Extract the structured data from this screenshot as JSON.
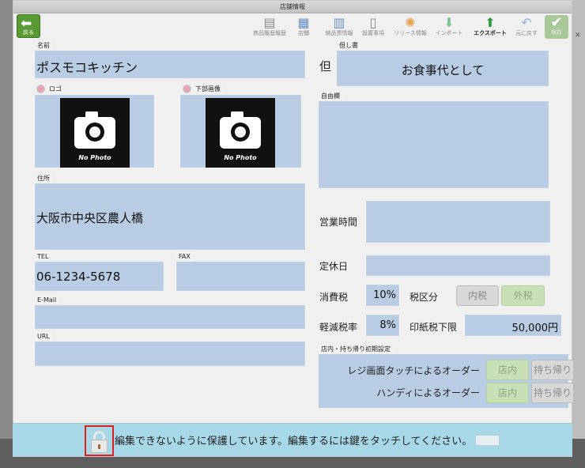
{
  "window": {
    "title": "店舗情報"
  },
  "toolbar": {
    "back_label": "戻る",
    "items": [
      {
        "label": "商品履歴履歴",
        "icon": "register-icon"
      },
      {
        "label": "店舗",
        "icon": "store-form-icon"
      },
      {
        "label": "納品票情報",
        "icon": "document-icon"
      },
      {
        "label": "設置事項",
        "icon": "tablet-icon"
      },
      {
        "label": "リリース情報",
        "icon": "release-icon"
      },
      {
        "label": "インポート",
        "icon": "import-icon"
      },
      {
        "label": "エクスポート",
        "icon": "export-icon"
      },
      {
        "label": "元に戻す",
        "icon": "undo-icon"
      }
    ],
    "save_label": "保存"
  },
  "form": {
    "name": {
      "label": "名前",
      "value": "ポスモコキッチン"
    },
    "logo": {
      "label": "ロゴ",
      "placeholder": "No Photo"
    },
    "bottom_image": {
      "label": "下部画像",
      "placeholder": "No Photo"
    },
    "address": {
      "label": "住所",
      "value": "大阪市中央区農人橋"
    },
    "tel": {
      "label": "TEL",
      "value": "06-1234-5678"
    },
    "fax": {
      "label": "FAX",
      "value": ""
    },
    "email": {
      "label": "E-Mail",
      "value": ""
    },
    "url": {
      "label": "URL",
      "value": ""
    },
    "proviso": {
      "prefix": "但",
      "label": "但し書",
      "value": "お食事代として"
    },
    "free_text": {
      "label": "自由欄",
      "value": ""
    },
    "business_hours": {
      "label": "営業時間",
      "value": ""
    },
    "holiday": {
      "label": "定休日",
      "value": ""
    },
    "consumption_tax": {
      "label": "消費税",
      "value": "10%"
    },
    "tax_category": {
      "label": "税区分",
      "options": [
        "内税",
        "外税"
      ],
      "selected": "外税"
    },
    "reduced_tax": {
      "label": "軽減税率",
      "value": "8%"
    },
    "stamp_duty_limit": {
      "label": "印紙税下限",
      "value": "50,000円"
    },
    "dine_default": {
      "label": "店内・持ち帰り初期設定",
      "register_label": "レジ画面タッチによるオーダー",
      "handy_label": "ハンディによるオーダー",
      "options": [
        "店内",
        "持ち帰り"
      ]
    }
  },
  "lock": {
    "message": "編集できないように保護しています。編集するには鍵をタッチしてください。"
  },
  "colors": {
    "field_bg": "#b8cce4",
    "lock_bar": "#a8d8e8",
    "accent_green": "#5a9a32"
  }
}
